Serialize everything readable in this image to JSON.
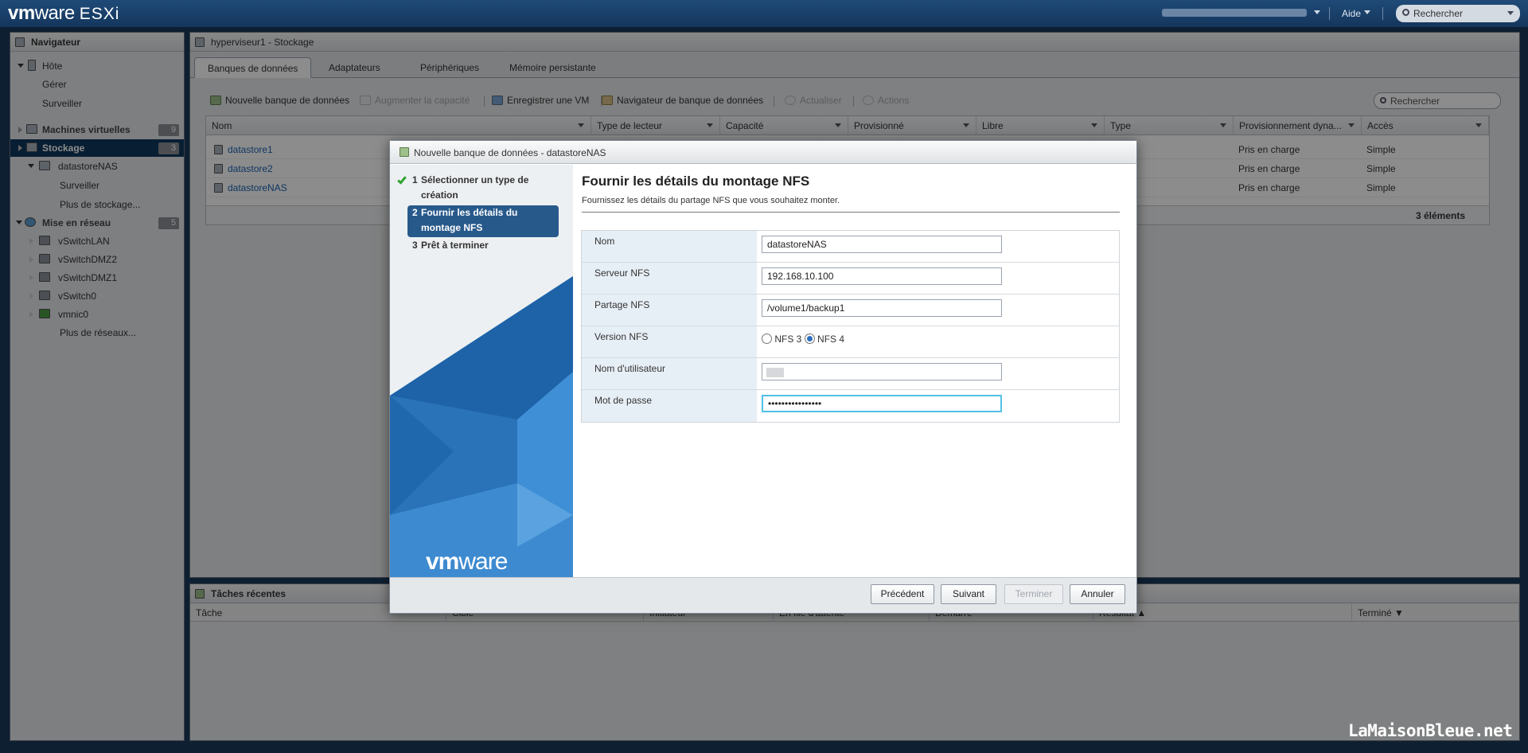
{
  "topbar": {
    "logo_vm": "vm",
    "logo_ware": "ware",
    "logo_product": "ESXi",
    "help_label": "Aide",
    "search_placeholder": "Rechercher"
  },
  "navigator": {
    "title": "Navigateur",
    "items": [
      {
        "label": "Hôte"
      },
      {
        "label": "Gérer"
      },
      {
        "label": "Surveiller"
      },
      {
        "label": "Machines virtuelles",
        "count": "9"
      },
      {
        "label": "Stockage",
        "count": "3"
      },
      {
        "label": "datastoreNAS"
      },
      {
        "label": "Surveiller"
      },
      {
        "label": "Plus de stockage..."
      },
      {
        "label": "Mise en réseau",
        "count": "5"
      },
      {
        "label": "vSwitchLAN"
      },
      {
        "label": "vSwitchDMZ2"
      },
      {
        "label": "vSwitchDMZ1"
      },
      {
        "label": "vSwitch0"
      },
      {
        "label": "vmnic0"
      },
      {
        "label": "Plus de réseaux..."
      }
    ]
  },
  "main": {
    "title": "hyperviseur1 - Stockage",
    "tabs": [
      "Banques de données",
      "Adaptateurs",
      "Périphériques",
      "Mémoire persistante"
    ],
    "toolbar": {
      "new_datastore": "Nouvelle banque de données",
      "increase_capacity": "Augmenter la capacité",
      "register_vm": "Enregistrer une VM",
      "datastore_browser": "Navigateur de banque de données",
      "refresh": "Actualiser",
      "actions": "Actions"
    },
    "search_placeholder": "Rechercher",
    "columns": [
      "Nom",
      "Type de lecteur",
      "Capacité",
      "Provisionné",
      "Libre",
      "Type",
      "Provisionnement dyna...",
      "Accès"
    ],
    "rows": [
      {
        "name": "datastore1",
        "thin": "Pris en charge",
        "access": "Simple"
      },
      {
        "name": "datastore2",
        "thin": "Pris en charge",
        "access": "Simple"
      },
      {
        "name": "datastoreNAS",
        "thin": "Pris en charge",
        "access": "Simple"
      }
    ],
    "row_count": "3 éléments"
  },
  "tasks": {
    "title": "Tâches récentes",
    "columns": [
      "Tâche",
      "Cible",
      "Initiateur",
      "En file d'attente",
      "Démarré",
      "Résultat ▲",
      "Terminé ▼"
    ]
  },
  "dialog": {
    "title": "Nouvelle banque de données - datastoreNAS",
    "steps": [
      {
        "num": "1",
        "label": "Sélectionner un type de création"
      },
      {
        "num": "2",
        "label": "Fournir les détails du montage NFS"
      },
      {
        "num": "3",
        "label": "Prêt à terminer"
      }
    ],
    "brand_vm": "vm",
    "brand_ware": "ware",
    "heading": "Fournir les détails du montage NFS",
    "subtitle": "Fournissez les détails du partage NFS que vous souhaitez monter.",
    "fields": {
      "name_label": "Nom",
      "name_value": "datastoreNAS",
      "server_label": "Serveur NFS",
      "server_value": "192.168.10.100",
      "share_label": "Partage NFS",
      "share_value": "/volume1/backup1",
      "version_label": "Version NFS",
      "nfs3_label": "NFS 3",
      "nfs4_label": "NFS 4",
      "username_label": "Nom d'utilisateur",
      "password_label": "Mot de passe",
      "password_value": "••••••••••••••••"
    },
    "buttons": {
      "back": "Précédent",
      "next": "Suivant",
      "finish": "Terminer",
      "cancel": "Annuler"
    }
  },
  "watermark": "LaMaisonBleue.net"
}
